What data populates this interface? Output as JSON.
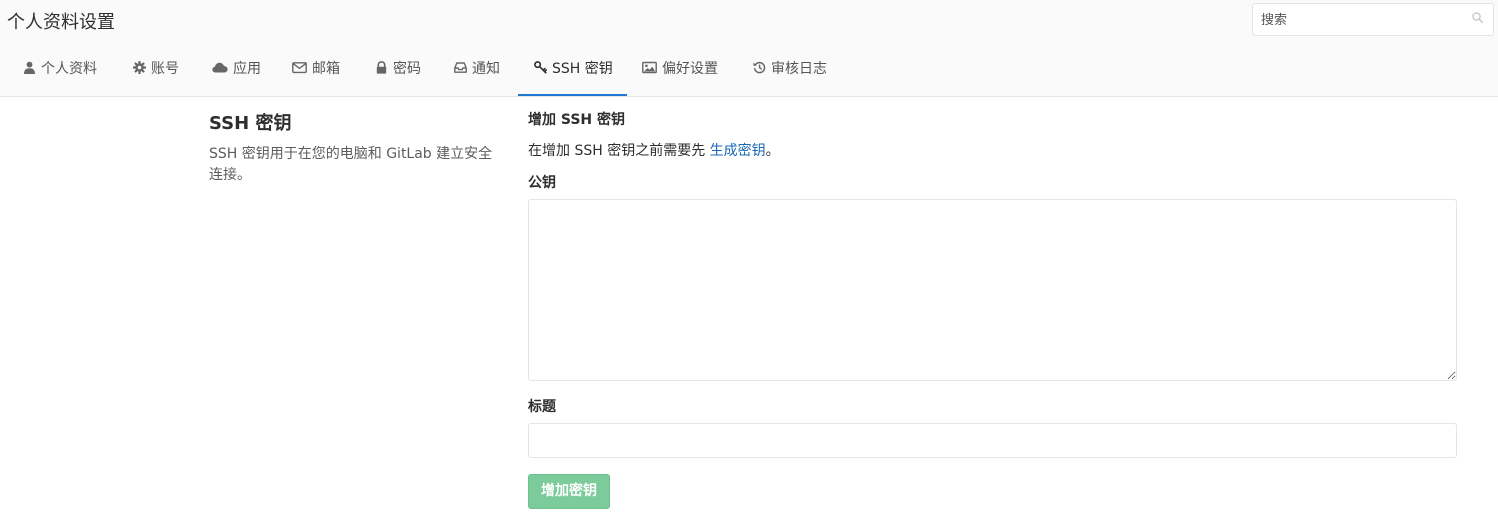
{
  "header": {
    "title": "个人资料设置",
    "search_placeholder": "搜索"
  },
  "tabs": [
    {
      "label": "个人资料",
      "icon": "user-icon"
    },
    {
      "label": "账号",
      "icon": "gear-icon"
    },
    {
      "label": "应用",
      "icon": "cloud-icon"
    },
    {
      "label": "邮箱",
      "icon": "envelope-icon"
    },
    {
      "label": "密码",
      "icon": "lock-icon"
    },
    {
      "label": "通知",
      "icon": "inbox-icon"
    },
    {
      "label": "SSH 密钥",
      "icon": "key-icon",
      "active": true
    },
    {
      "label": "偏好设置",
      "icon": "image-icon"
    },
    {
      "label": "审核日志",
      "icon": "history-icon"
    }
  ],
  "left": {
    "title": "SSH 密钥",
    "description": "SSH 密钥用于在您的电脑和 GitLab 建立安全连接。"
  },
  "form": {
    "heading": "增加 SSH 密钥",
    "help_prefix": "在增加 SSH 密钥之前需要先 ",
    "help_link": "生成密钥",
    "help_suffix": "。",
    "key_label": "公钥",
    "key_value": "",
    "title_label": "标题",
    "title_value": "",
    "submit_label": "增加密钥"
  },
  "colors": {
    "active_tab_border": "#1f78d1",
    "link": "#1b69b6",
    "submit_button": "#7ccb9a"
  }
}
